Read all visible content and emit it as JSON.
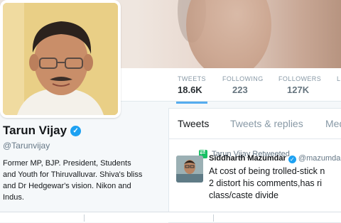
{
  "profile": {
    "name": "Tarun Vijay",
    "handle": "@Tarunvijay",
    "bio_lines": [
      "Former MP, BJP. President, Students",
      "and Youth for Thiruvalluvar. Shiva's bliss",
      "and Dr Hedgewar's vision. Nikon and",
      "Indus."
    ]
  },
  "stats": [
    {
      "label": "TWEETS",
      "value": "18.6K"
    },
    {
      "label": "FOLLOWING",
      "value": "223"
    },
    {
      "label": "FOLLOWERS",
      "value": "127K"
    },
    {
      "label": "L",
      "value": ""
    }
  ],
  "tabs": [
    "Tweets",
    "Tweets & replies",
    "Med"
  ],
  "tweet": {
    "retweet_label": "Tarun Vijay Retweeted",
    "author": "Siddharth Mazumdar",
    "author_handle": "@mazumda",
    "lines": [
      "At cost of being trolled-stick n",
      "2 distort his comments,has ri",
      "class/caste divide"
    ]
  },
  "colors": {
    "accent": "#55acee",
    "verified": "#1da1f2",
    "retweet": "#17bf63"
  }
}
